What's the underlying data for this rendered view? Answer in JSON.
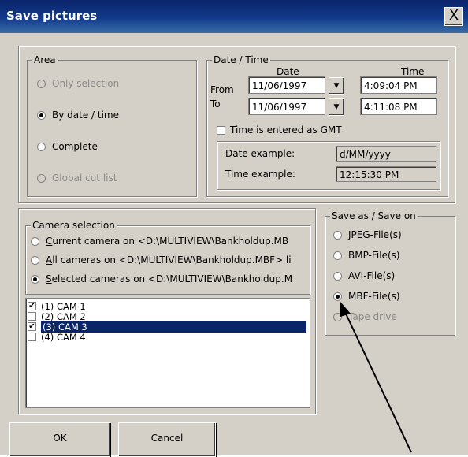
{
  "window": {
    "title": "Save pictures",
    "close_glyph": "X"
  },
  "area": {
    "label": "Area",
    "options": [
      {
        "label": "Only selection",
        "enabled": false,
        "selected": false
      },
      {
        "label": "By date / time",
        "enabled": true,
        "selected": true
      },
      {
        "label": "Complete",
        "enabled": true,
        "selected": false
      },
      {
        "label": "Global cut list",
        "enabled": false,
        "selected": false
      }
    ]
  },
  "datetime": {
    "label": "Date / Time",
    "col_date": "Date",
    "col_time": "Time",
    "from_label": "From",
    "to_label": "To",
    "from_date": "11/06/1997",
    "from_time": "4:09:04 PM",
    "to_date": "11/06/1997",
    "to_time": "4:11:08 PM",
    "gmt_label": "Time is entered as GMT",
    "gmt_checked": false,
    "date_example_label": "Date example:",
    "date_example_value": "d/MM/yyyy",
    "time_example_label": "Time example:",
    "time_example_value": "12:15:30 PM"
  },
  "camera": {
    "label": "Camera selection",
    "options": [
      {
        "prefix": "",
        "ul": "C",
        "rest": "urrent camera on <D:\\MULTIVIEW\\Bankholdup.MB",
        "selected": false
      },
      {
        "prefix": "",
        "ul": "A",
        "rest": "ll cameras on <D:\\MULTIVIEW\\Bankholdup.MBF> li",
        "selected": false
      },
      {
        "prefix": "",
        "ul": "S",
        "rest": "elected cameras on <D:\\MULTIVIEW\\Bankholdup.M",
        "selected": true
      }
    ],
    "cams": [
      {
        "label": "(1) CAM 1",
        "checked": true,
        "highlighted": false
      },
      {
        "label": "(2) CAM 2",
        "checked": false,
        "highlighted": false
      },
      {
        "label": "(3) CAM 3",
        "checked": true,
        "highlighted": true
      },
      {
        "label": "(4) CAM 4",
        "checked": false,
        "highlighted": false
      }
    ]
  },
  "save_as": {
    "label": "Save as / Save on",
    "options": [
      {
        "label": "JPEG-File(s)",
        "enabled": true,
        "selected": false
      },
      {
        "label": "BMP-File(s)",
        "enabled": true,
        "selected": false
      },
      {
        "label": "AVI-File(s)",
        "enabled": true,
        "selected": false
      },
      {
        "label": "MBF-File(s)",
        "enabled": true,
        "selected": true
      },
      {
        "label": "Tape drive",
        "enabled": false,
        "selected": false
      }
    ]
  },
  "buttons": {
    "ok": "OK",
    "cancel": "Cancel"
  },
  "icons": {
    "check": "✔",
    "dropdown": "▼"
  }
}
